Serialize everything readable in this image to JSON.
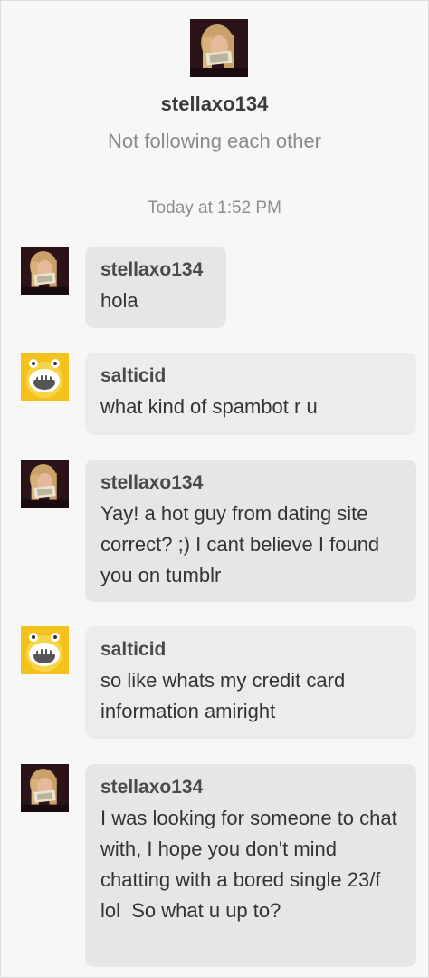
{
  "conversation": {
    "partner_username": "stellaxo134",
    "relationship_status": "Not following each other"
  },
  "timestamp": "Today at 1:52 PM",
  "messages": [
    {
      "sender": "stellaxo134",
      "text": "hola",
      "avatar": "stellaxo134-avatar"
    },
    {
      "sender": "salticid",
      "text": "what kind of spambot r u",
      "avatar": "salticid-avatar"
    },
    {
      "sender": "stellaxo134",
      "text": "Yay! a hot guy from dating site correct? ;) I cant believe I found you on tumblr",
      "avatar": "stellaxo134-avatar"
    },
    {
      "sender": "salticid",
      "text": "so like whats my credit card information amiright",
      "avatar": "salticid-avatar"
    },
    {
      "sender": "stellaxo134",
      "text": "I was looking for someone to chat with, I hope you don't mind chatting with a bored single 23/f lol  So what u up to?",
      "avatar": "stellaxo134-avatar"
    }
  ]
}
